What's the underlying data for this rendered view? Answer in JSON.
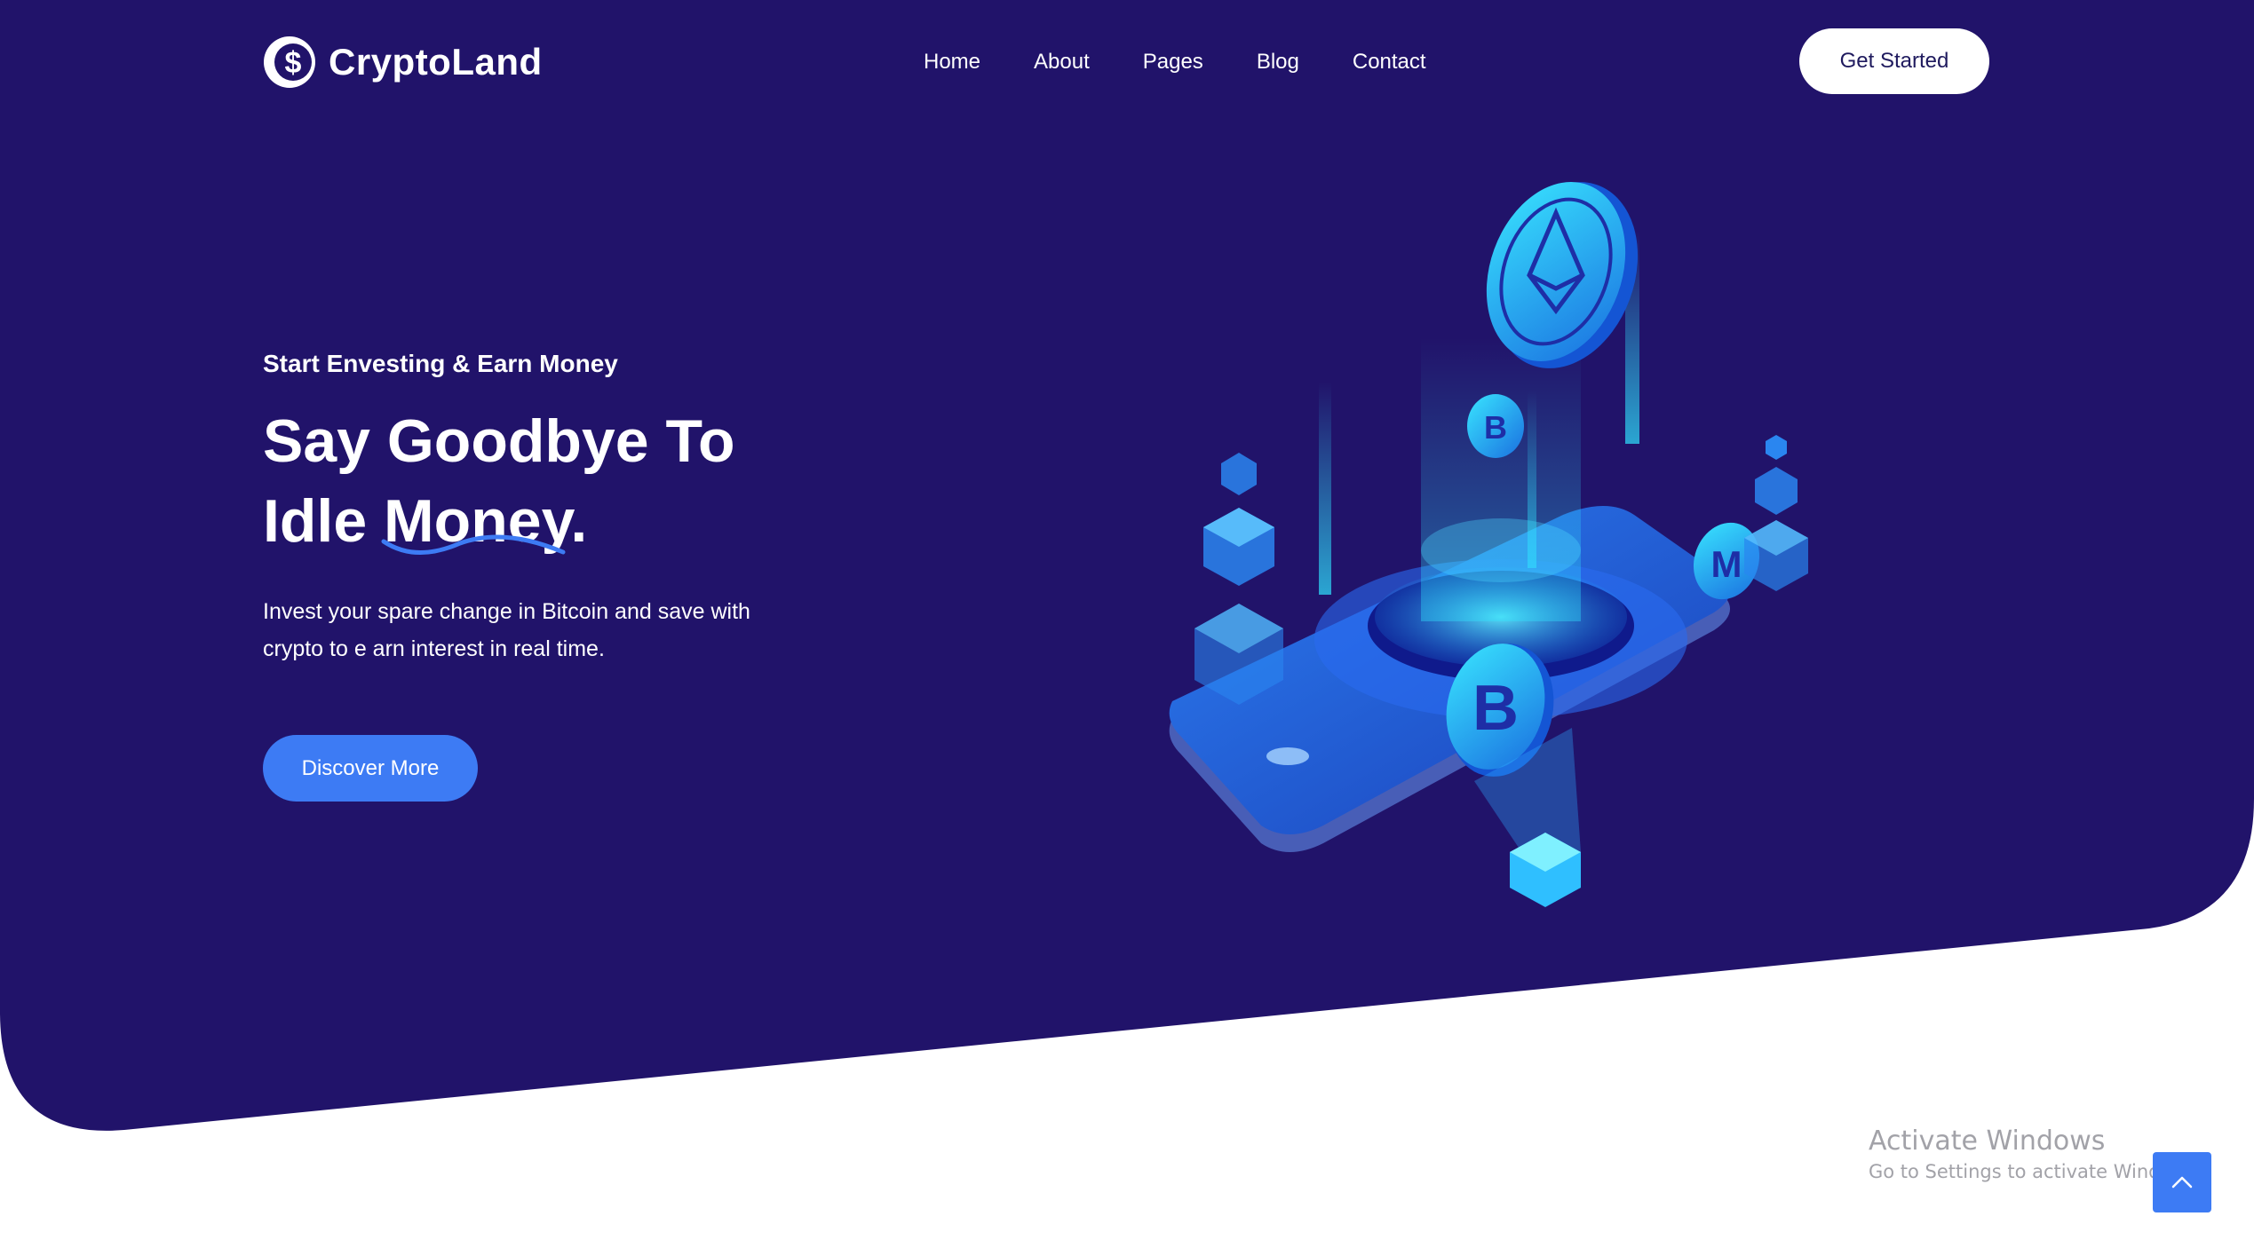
{
  "brand": {
    "name": "CryptoLand",
    "logo_icon": "dollar-coin-icon"
  },
  "nav": {
    "items": [
      "Home",
      "About",
      "Pages",
      "Blog",
      "Contact"
    ]
  },
  "header": {
    "cta_label": "Get Started"
  },
  "hero": {
    "eyebrow": "Start Envesting & Earn Money",
    "headline_line1": "Say Goodbye To",
    "headline_line2": "Idle Money.",
    "description": "Invest your spare change in Bitcoin and save with crypto to e arn interest in real time.",
    "button_label": "Discover More",
    "illustration_icon": "crypto-phone-illustration"
  },
  "overlay": {
    "watermark_title": "Activate Windows",
    "watermark_subtitle": "Go to Settings to activate Windows.",
    "scroll_top_icon": "chevron-up-icon"
  },
  "colors": {
    "hero_background": "#21136a",
    "accent_blue": "#3d7bf4",
    "white": "#ffffff",
    "cyan": "#2fe4ff"
  }
}
